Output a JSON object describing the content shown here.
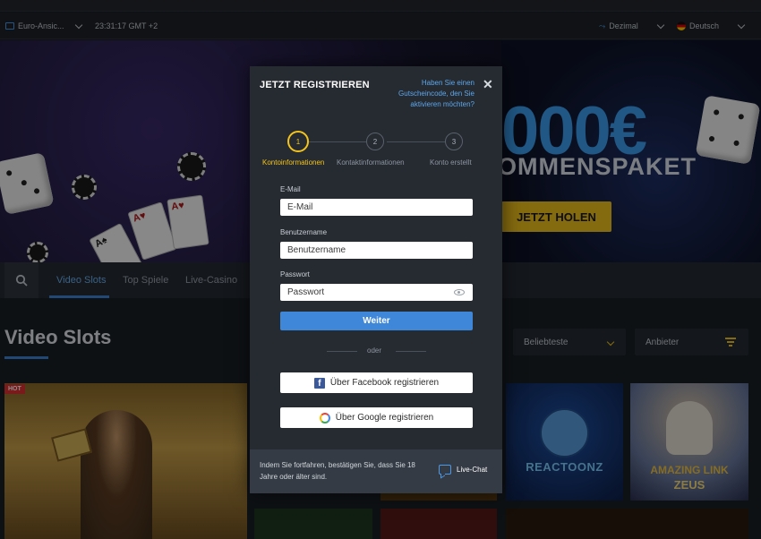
{
  "settings": {
    "odds_format": "Euro-Ansic...",
    "time": "23:31:17 GMT +2",
    "odds_display": "Dezimal",
    "language": "Deutsch"
  },
  "hero": {
    "amount": "000€",
    "package": "OMMENSPAKET",
    "cta": "JETZT HOLEN"
  },
  "nav": {
    "tabs": [
      {
        "label": "Video Slots",
        "active": true
      },
      {
        "label": "Top Spiele",
        "active": false
      },
      {
        "label": "Live-Casino",
        "active": false
      }
    ]
  },
  "section": {
    "title": "Video Slots",
    "sort_label": "Beliebteste",
    "filter_label": "Anbieter"
  },
  "tiles": {
    "hot_badge": "HOT",
    "reactoonz": "REACTOONZ",
    "amazing_link_line1": "AMAZING LINK",
    "amazing_link_line2": "ZEUS"
  },
  "modal": {
    "title": "JETZT REGISTRIEREN",
    "promo_link": "Haben Sie einen Gutscheincode, den Sie aktivieren möchten?",
    "close": "✕",
    "steps": [
      {
        "num": "1",
        "label": "Kontoinformationen",
        "active": true
      },
      {
        "num": "2",
        "label": "Kontaktinformationen",
        "active": false
      },
      {
        "num": "3",
        "label": "Konto erstellt",
        "active": false
      }
    ],
    "email_label": "E-Mail",
    "email_placeholder": "E-Mail",
    "username_label": "Benutzername",
    "username_placeholder": "Benutzername",
    "password_label": "Passwort",
    "password_placeholder": "Passwort",
    "submit": "Weiter",
    "divider": "oder",
    "facebook_button": "Über Facebook registrieren",
    "google_button": "Über Google registrieren",
    "legal": "Indem Sie fortfahren, bestätigen Sie, dass Sie 18 Jahre oder älter sind.",
    "chat": "Live-Chat"
  },
  "colors": {
    "accent_blue": "#3f87d8",
    "accent_yellow": "#f2c41c",
    "modal_bg": "#262a31"
  }
}
